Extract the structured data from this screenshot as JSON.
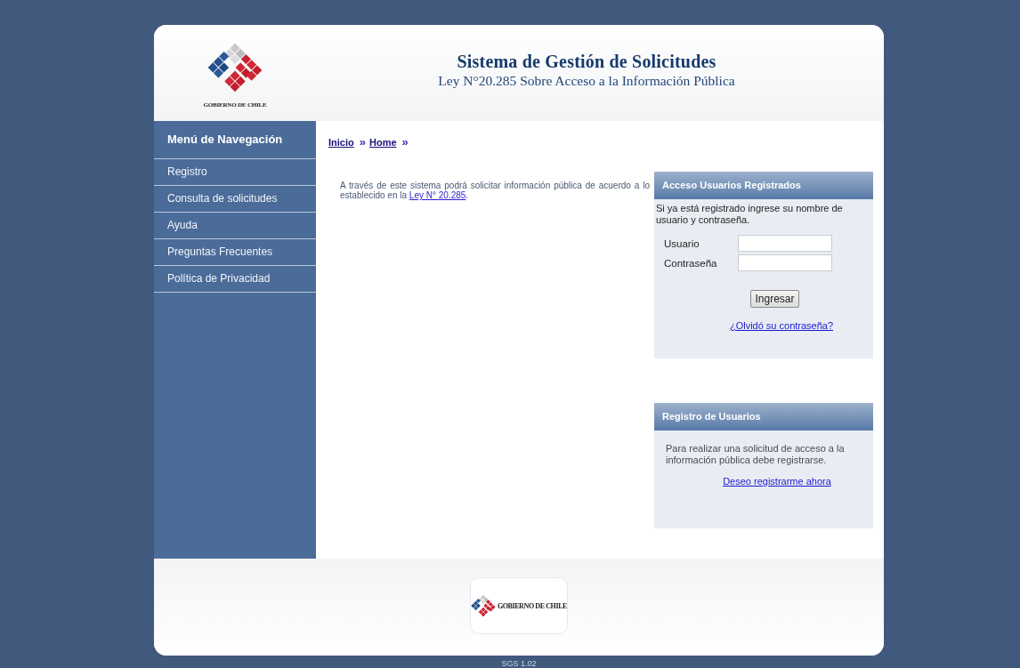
{
  "header": {
    "logo_text": "GOBIERNO DE CHILE",
    "title": "Sistema de Gestión de Solicitudes",
    "subtitle": "Ley N°20.285 Sobre Acceso a la Información Pública"
  },
  "sidebar": {
    "title": "Menú de Navegación",
    "items": [
      {
        "label": "Registro"
      },
      {
        "label": "Consulta de solicitudes"
      },
      {
        "label": "Ayuda"
      },
      {
        "label": "Preguntas Frecuentes"
      },
      {
        "label": "Política de Privacidad"
      }
    ]
  },
  "breadcrumb": [
    {
      "kind": "link",
      "text": "Inicio"
    },
    {
      "kind": "separator",
      "text": "»"
    },
    {
      "kind": "link",
      "text": "Home"
    },
    {
      "kind": "separator",
      "text": "»"
    }
  ],
  "intro": {
    "text": "A través de este sistema podrá solicitar información pública de acuerdo a lo establecido en la ",
    "link": "Ley N° 20.285",
    "text_after": "."
  },
  "login_panel": {
    "title": "Acceso Usuarios Registrados",
    "description": "Si ya está registrado ingrese su nombre de usuario y contraseña.",
    "fields": [
      {
        "label": "Usuario"
      },
      {
        "label": "Contraseña"
      }
    ],
    "button": "Ingresar",
    "link": "¿Olvidó su contraseña?"
  },
  "register_panel": {
    "title": "Registro de Usuarios",
    "description": "Para realizar una solicitud de acceso a la información pública debe registrarse.",
    "link": "Deseo registrarme ahora"
  },
  "footer": {
    "logo_text": "GOBIERNO DE CHILE"
  },
  "version": "SGS 1.02"
}
